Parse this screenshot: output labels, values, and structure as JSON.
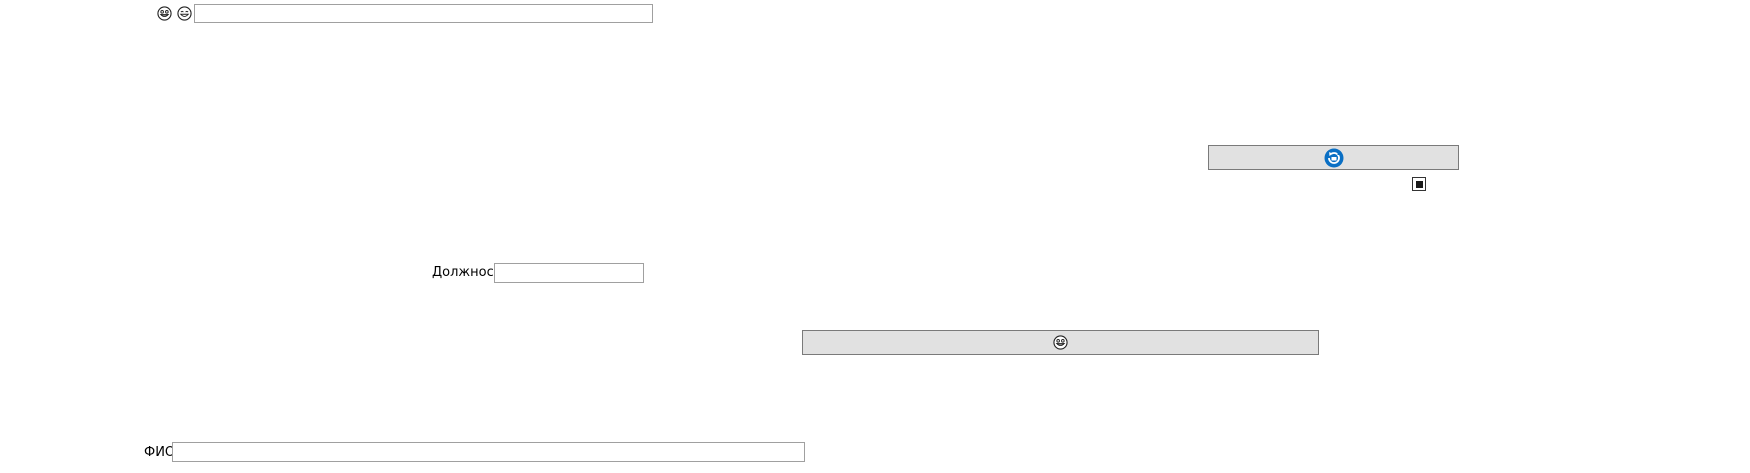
{
  "top_toolbar": {
    "icons": [
      "smiley-grin-icon",
      "smiley-laugh-icon"
    ],
    "field_value": ""
  },
  "position_field": {
    "label": "Должность",
    "value": ""
  },
  "fio_field": {
    "label": "ФИО",
    "value": ""
  },
  "refresh_button": {
    "icon": "refresh-icon",
    "accent_color": "#0a6fc4"
  },
  "checkbox": {
    "checked": true
  },
  "emoji_button": {
    "icon": "smiley-grin-icon"
  }
}
